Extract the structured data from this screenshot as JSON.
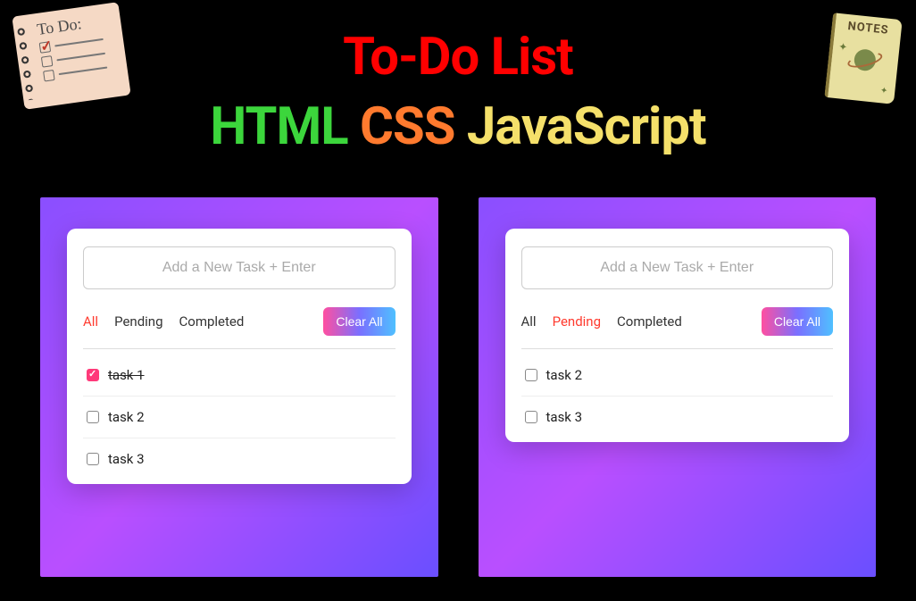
{
  "header": {
    "title1": "To-Do List",
    "html": "HTML",
    "css": "CSS",
    "js": "JavaScript"
  },
  "stickers": {
    "todo_label": "To Do:",
    "notes_label": "NOTES"
  },
  "app_left": {
    "placeholder": "Add a New Task + Enter",
    "filters": {
      "all": "All",
      "pending": "Pending",
      "completed": "Completed",
      "active": "all"
    },
    "clear_label": "Clear All",
    "tasks": [
      {
        "label": "task 1",
        "checked": true
      },
      {
        "label": "task 2",
        "checked": false
      },
      {
        "label": "task 3",
        "checked": false
      }
    ]
  },
  "app_right": {
    "placeholder": "Add a New Task + Enter",
    "filters": {
      "all": "All",
      "pending": "Pending",
      "completed": "Completed",
      "active": "pending"
    },
    "clear_label": "Clear All",
    "tasks": [
      {
        "label": "task 2",
        "checked": false
      },
      {
        "label": "task 3",
        "checked": false
      }
    ]
  }
}
